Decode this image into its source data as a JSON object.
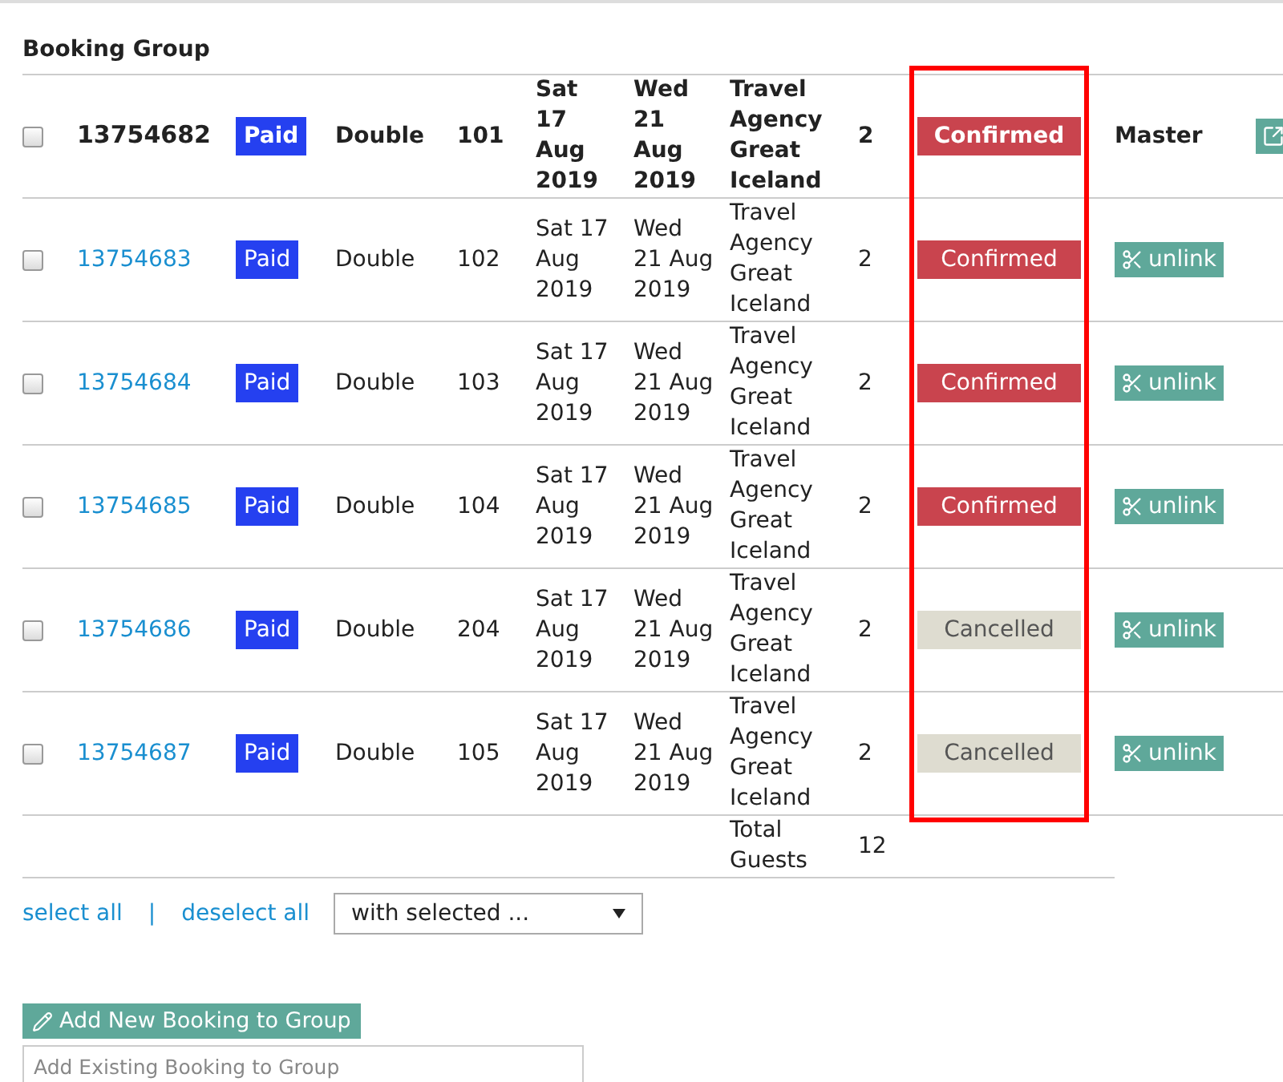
{
  "section_title": "Booking Group",
  "bookings": [
    {
      "kind": "master",
      "checked": false,
      "id": "13754682",
      "payment": "Paid",
      "room_type": "Double",
      "room": "101",
      "arrival": "Sat 17 Aug 2019",
      "departure": "Wed 21 Aug 2019",
      "agency": "Travel Agency Great Iceland",
      "guests": "2",
      "status": {
        "text": "Confirmed",
        "kind": "confirmed"
      },
      "role": "Master"
    },
    {
      "kind": "linked",
      "checked": false,
      "id": "13754683",
      "payment": "Paid",
      "room_type": "Double",
      "room": "102",
      "arrival": "Sat 17 Aug 2019",
      "departure": "Wed 21 Aug 2019",
      "agency": "Travel Agency Great Iceland",
      "guests": "2",
      "status": {
        "text": "Confirmed",
        "kind": "confirmed"
      },
      "action": "unlink"
    },
    {
      "kind": "linked",
      "checked": false,
      "id": "13754684",
      "payment": "Paid",
      "room_type": "Double",
      "room": "103",
      "arrival": "Sat 17 Aug 2019",
      "departure": "Wed 21 Aug 2019",
      "agency": "Travel Agency Great Iceland",
      "guests": "2",
      "status": {
        "text": "Confirmed",
        "kind": "confirmed"
      },
      "action": "unlink"
    },
    {
      "kind": "linked",
      "checked": false,
      "id": "13754685",
      "payment": "Paid",
      "room_type": "Double",
      "room": "104",
      "arrival": "Sat 17 Aug 2019",
      "departure": "Wed 21 Aug 2019",
      "agency": "Travel Agency Great Iceland",
      "guests": "2",
      "status": {
        "text": "Confirmed",
        "kind": "confirmed"
      },
      "action": "unlink"
    },
    {
      "kind": "linked",
      "checked": false,
      "id": "13754686",
      "payment": "Paid",
      "room_type": "Double",
      "room": "204",
      "arrival": "Sat 17 Aug 2019",
      "departure": "Wed 21 Aug 2019",
      "agency": "Travel Agency Great Iceland",
      "guests": "2",
      "status": {
        "text": "Cancelled",
        "kind": "cancelled"
      },
      "action": "unlink"
    },
    {
      "kind": "linked",
      "checked": false,
      "id": "13754687",
      "payment": "Paid",
      "room_type": "Double",
      "room": "105",
      "arrival": "Sat 17 Aug 2019",
      "departure": "Wed 21 Aug 2019",
      "agency": "Travel Agency Great Iceland",
      "guests": "2",
      "status": {
        "text": "Cancelled",
        "kind": "cancelled"
      },
      "action": "unlink"
    }
  ],
  "totals": {
    "label": "Total Guests",
    "value": "12"
  },
  "select_all": "select all",
  "separator": "|",
  "deselect_all": "deselect all",
  "bulk_action": {
    "value": "with selected ..."
  },
  "add_new_button": "Add New Booking to Group",
  "add_existing": {
    "placeholder": "Add Existing Booking to Group"
  }
}
